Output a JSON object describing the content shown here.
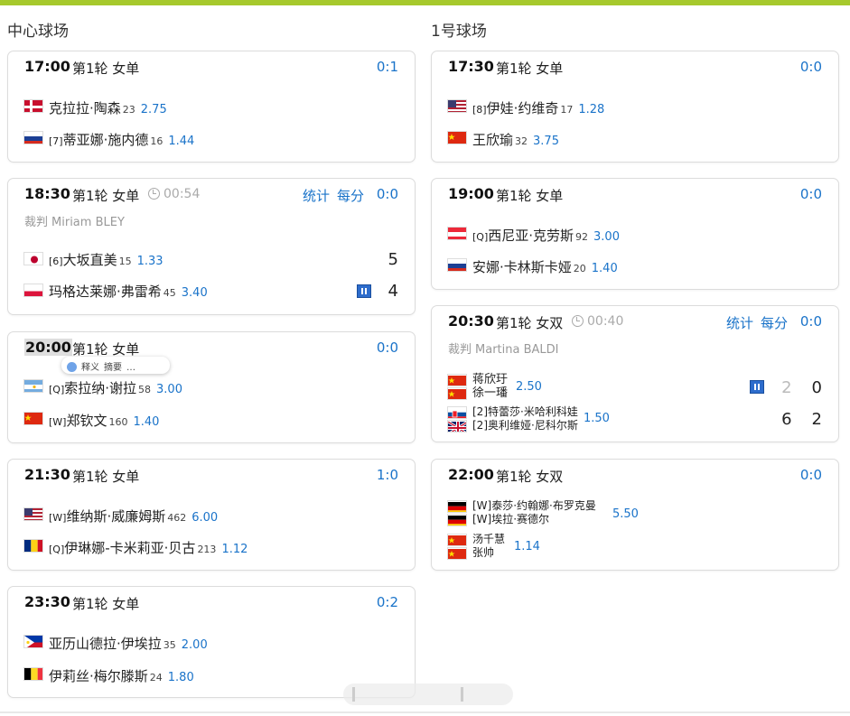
{
  "courts": [
    {
      "title": "中心球场",
      "matches": [
        {
          "time": "17:00",
          "round": "第1轮 女单",
          "score_link": "0:1",
          "players": [
            {
              "seed": "",
              "name": "克拉拉·陶森",
              "rank": "23",
              "odds": "2.75",
              "flag": "denmark"
            },
            {
              "seed": "[7]",
              "name": "蒂亚娜·施内德",
              "rank": "16",
              "odds": "1.44",
              "flag": "russia"
            }
          ]
        },
        {
          "time": "18:30",
          "round": "第1轮 女单",
          "duration": "00:54",
          "stats_label": "统计",
          "point_label": "每分",
          "score_link": "0:0",
          "umpire_label": "裁判",
          "umpire": "Miriam BLEY",
          "players": [
            {
              "seed": "[6]",
              "name": "大坂直美",
              "rank": "15",
              "odds": "1.33",
              "flag": "japan",
              "sets": "5"
            },
            {
              "seed": "",
              "name": "玛格达莱娜·弗雷希",
              "rank": "45",
              "odds": "3.40",
              "flag": "poland",
              "sets": "4",
              "serving": true
            }
          ]
        },
        {
          "time": "20:00",
          "round": "第1轮 女单",
          "score_link": "0:0",
          "players": [
            {
              "seed": "[Q]",
              "name": "索拉纳·谢拉",
              "rank": "58",
              "odds": "3.00",
              "flag": "argentina"
            },
            {
              "seed": "[W]",
              "name": "郑钦文",
              "rank": "160",
              "odds": "1.40",
              "flag": "china"
            }
          ]
        },
        {
          "time": "21:30",
          "round": "第1轮 女单",
          "score_link": "1:0",
          "players": [
            {
              "seed": "[W]",
              "name": "维纳斯·威廉姆斯",
              "rank": "462",
              "odds": "6.00",
              "flag": "usa"
            },
            {
              "seed": "[Q]",
              "name": "伊琳娜-卡米莉亚·贝古",
              "rank": "213",
              "odds": "1.12",
              "flag": "romania"
            }
          ]
        },
        {
          "time": "23:30",
          "round": "第1轮 女单",
          "score_link": "0:2",
          "players": [
            {
              "seed": "",
              "name": "亚历山德拉·伊埃拉",
              "rank": "35",
              "odds": "2.00",
              "flag": "philippines"
            },
            {
              "seed": "",
              "name": "伊莉丝·梅尔滕斯",
              "rank": "24",
              "odds": "1.80",
              "flag": "belgium"
            }
          ]
        }
      ]
    },
    {
      "title": "1号球场",
      "matches": [
        {
          "time": "17:30",
          "round": "第1轮 女单",
          "score_link": "0:0",
          "players": [
            {
              "seed": "[8]",
              "name": "伊娃·约维奇",
              "rank": "17",
              "odds": "1.28",
              "flag": "usa"
            },
            {
              "seed": "",
              "name": "王欣瑜",
              "rank": "32",
              "odds": "3.75",
              "flag": "china"
            }
          ]
        },
        {
          "time": "19:00",
          "round": "第1轮 女单",
          "score_link": "0:0",
          "players": [
            {
              "seed": "[Q]",
              "name": "西尼亚·克劳斯",
              "rank": "92",
              "odds": "3.00",
              "flag": "austria"
            },
            {
              "seed": "",
              "name": "安娜·卡林斯卡娅",
              "rank": "20",
              "odds": "1.40",
              "flag": "russia"
            }
          ]
        },
        {
          "time": "20:30",
          "round": "第1轮 女双",
          "duration": "00:40",
          "stats_label": "统计",
          "point_label": "每分",
          "score_link": "0:0",
          "umpire_label": "裁判",
          "umpire": "Martina BALDI",
          "teams": [
            {
              "names": [
                "蒋欣玗",
                "徐一璠"
              ],
              "flags": [
                "china",
                "china"
              ],
              "odds": "2.50",
              "game": "2",
              "set": "0",
              "serving": true
            },
            {
              "names": [
                "[2]特蕾莎·米哈利科娃",
                "[2]奥利维娅·尼科尔斯"
              ],
              "flags": [
                "slovakia",
                "uk"
              ],
              "odds": "1.50",
              "game": "6",
              "set": "2"
            }
          ]
        },
        {
          "time": "22:00",
          "round": "第1轮 女双",
          "score_link": "0:0",
          "teams": [
            {
              "names": [
                "[W]泰莎·约翰娜·布罗克曼",
                "[W]埃拉·赛德尔"
              ],
              "flags": [
                "germany",
                "germany"
              ],
              "odds": "5.50"
            },
            {
              "names": [
                "汤千慧",
                "张帅"
              ],
              "flags": [
                "china",
                "china"
              ],
              "odds": "1.14"
            }
          ]
        }
      ]
    }
  ],
  "popup": {
    "explain": "释义",
    "summary": "摘要",
    "more": "…"
  },
  "colors": {
    "accent": "#a6c92c",
    "link": "#1a73c9",
    "serve": "#2d6ccc"
  }
}
